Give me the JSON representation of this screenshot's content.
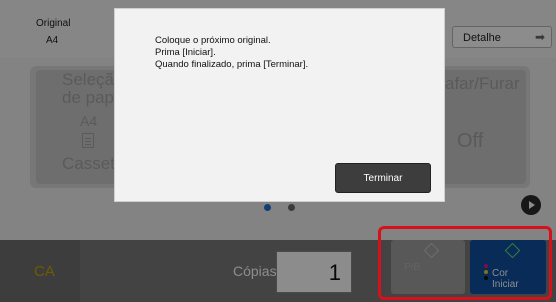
{
  "header": {
    "original_label": "Original",
    "original_value": "A4",
    "detail_label": "Detalhe"
  },
  "functions": {
    "paper_select_line1": "Seleção",
    "paper_select_line2": "de papel",
    "paper_size": "A4",
    "paper_source": "Cassete",
    "staple_label": "afar/Furar",
    "staple_value": "Off"
  },
  "dialog": {
    "line1": "Coloque o próximo original.",
    "line2": "Prima [Iniciar].",
    "line3": "Quando finalizado, prima [Terminar].",
    "end_button": "Terminar"
  },
  "pagination": {
    "active_color": "#1e73d2",
    "inactive_color": "#6a6a6a"
  },
  "bottom": {
    "ca_label": "CA",
    "copies_label": "Cópias",
    "copies_value": "1",
    "bw_label": "P/B",
    "color_line1": "Cor",
    "color_line2": "Iniciar"
  },
  "colors": {
    "accent_red": "#d8101b",
    "start_blue": "#0f4fa0",
    "ca_yellow": "#c9a400",
    "dot_magenta": "#e0198a",
    "dot_yellow": "#f2d01b",
    "dot_black": "#111111"
  }
}
